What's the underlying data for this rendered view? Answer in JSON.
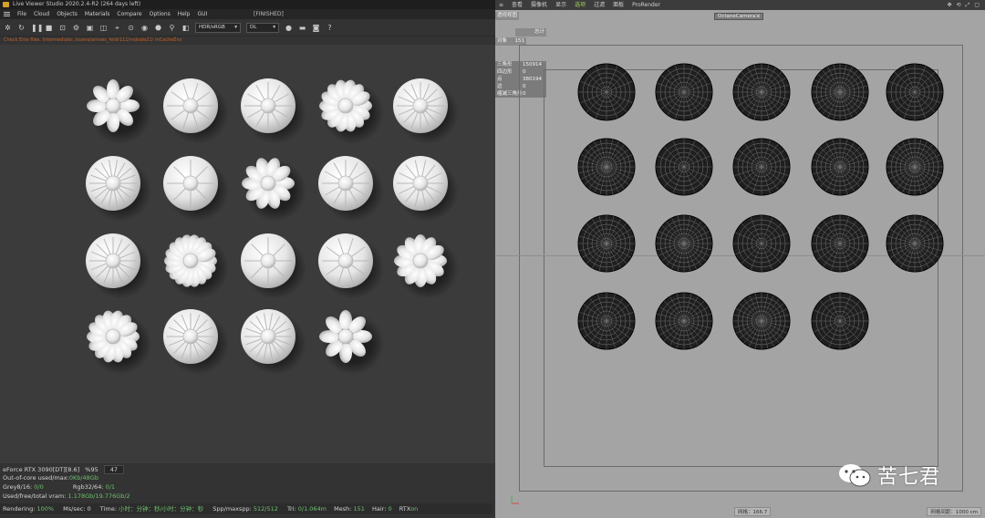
{
  "left_window": {
    "title": "Live Viewer Studio 2020.2.4-R2 (264 days left)",
    "status": "[FINISHED]",
    "menu": [
      "File",
      "Cloud",
      "Objects",
      "Materials",
      "Compare",
      "Options",
      "Help",
      "GUI"
    ],
    "toolbar": {
      "color_mode": "HDR/sRGB",
      "kernel": "DL"
    },
    "path_line": "Check Ems files.  Intermediate: /scene/arrows_feldr111/mdsale21/ mCacheEnv",
    "stats": {
      "gpu": "eForce RTX 3090[DT][8.6]",
      "gpu_percent": "%95",
      "gpu_temp": "47",
      "out_of_core_label": "Out-of-core used/max:",
      "out_of_core_value": "0Kb/48Gb",
      "grey_label": "Grey8/16:",
      "grey_value": "0/0",
      "rgb_label": "Rgb32/64:",
      "rgb_value": "0/1",
      "vram_label": "Used/free/total vram:",
      "vram_value": "1.178Gb/19.776Gb/2",
      "rendering_label": "Rendering:",
      "rendering_value": "100%",
      "mssec_label": "Ms/sec:",
      "mssec_value": "0",
      "time_label": "Time:",
      "time_value": "小时：分钟：秒/小时：分钟：秒",
      "spp_label": "Spp/maxspp:",
      "spp_value": "512/512",
      "tri_label": "Tri:",
      "tri_value": "0/1.064m",
      "mesh_label": "Mesh:",
      "mesh_value": "151",
      "hair_label": "Hair:",
      "hair_value": "0",
      "rtx_label": "RTX",
      "rtx_value": "on"
    }
  },
  "right_window": {
    "menu": [
      "查看",
      "摄像机",
      "显示",
      "选项",
      "过滤",
      "面板",
      "ProRender"
    ],
    "active_menu": "选项",
    "camera_label": "OctaneCamera",
    "view_label": "透视视图",
    "hud_total_label": "总计",
    "hud_object_label": "对象",
    "hud_object_value": "151",
    "hud_table": [
      {
        "k": "三角形",
        "v": "150914"
      },
      {
        "k": "四边形",
        "v": "0"
      },
      {
        "k": "点",
        "v": "380194"
      },
      {
        "k": "边",
        "v": "0"
      },
      {
        "k": "缩减三角形",
        "v": "0"
      }
    ],
    "scale_left": "网格：166.7",
    "scale_right": "网格间距：1000 cm"
  },
  "watermark": {
    "text": "苦七君"
  },
  "colors": {
    "accent_green": "#6dc06d",
    "path_orange": "#c5622a",
    "c4d_bg": "#a4a4a4"
  }
}
